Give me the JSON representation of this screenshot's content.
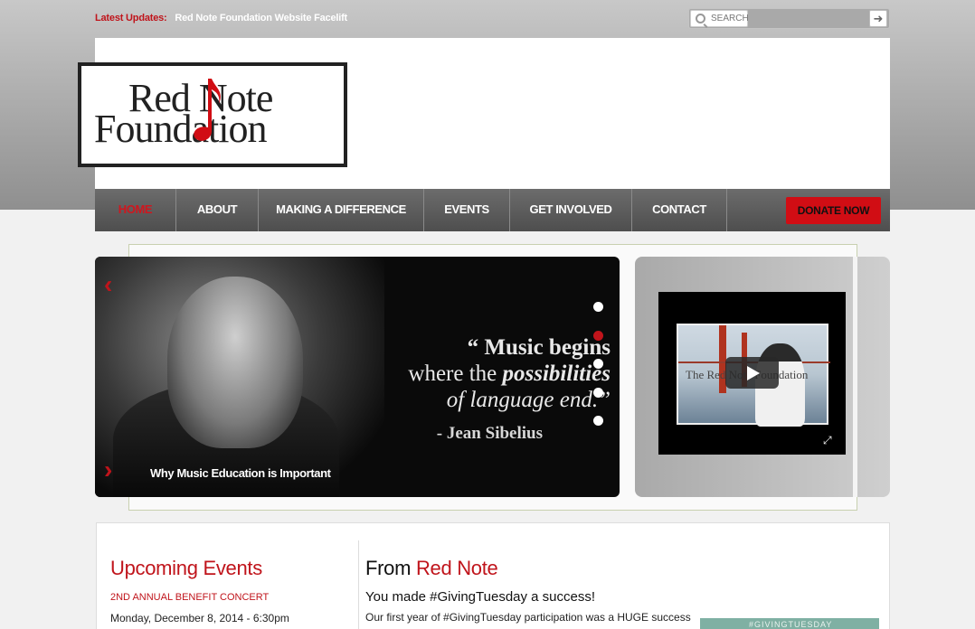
{
  "updates": {
    "label": "Latest Updates:",
    "text": "Red Note Foundation Website Facelift"
  },
  "search": {
    "placeholder": "SEARCH",
    "go_icon": "arrow-right-icon"
  },
  "logo": {
    "line1": "Red Note",
    "line2": "Foundation"
  },
  "nav": {
    "items": [
      "HOME",
      "ABOUT",
      "MAKING A DIFFERENCE",
      "EVENTS",
      "GET INVOLVED",
      "CONTACT"
    ],
    "active": "HOME",
    "donate": "DONATE NOW"
  },
  "slider": {
    "quote_l1": "“ Music begins",
    "quote_l2a": "where the ",
    "quote_l2b": "possibilities",
    "quote_l3": "of language end.”",
    "author": "- Jean Sibelius",
    "caption": "Why Music Education is Important",
    "active_dot": 2,
    "dot_count": 5,
    "prev_icon": "chevron-left-icon",
    "next_icon": "chevron-right-icon"
  },
  "video": {
    "watermark": "The Red Note Foundation",
    "play_icon": "play-icon",
    "fullscreen_icon": "fullscreen-icon"
  },
  "events": {
    "heading": "Upcoming Events",
    "name": "2ND ANNUAL BENEFIT CONCERT",
    "date": "Monday, December 8, 2014 - 6:30pm"
  },
  "blog": {
    "heading_plain": "From ",
    "heading_red": "Red Note",
    "post_title": "You made #GivingTuesday a success!",
    "post_excerpt": "Our first year of #GivingTuesday participation was a HUGE success",
    "thumb_text": "#GIVINGTUESDAY"
  },
  "colors": {
    "accent": "#c0141b",
    "nav_bg": "#5a5a5a",
    "donate_bg": "#d10d14"
  }
}
